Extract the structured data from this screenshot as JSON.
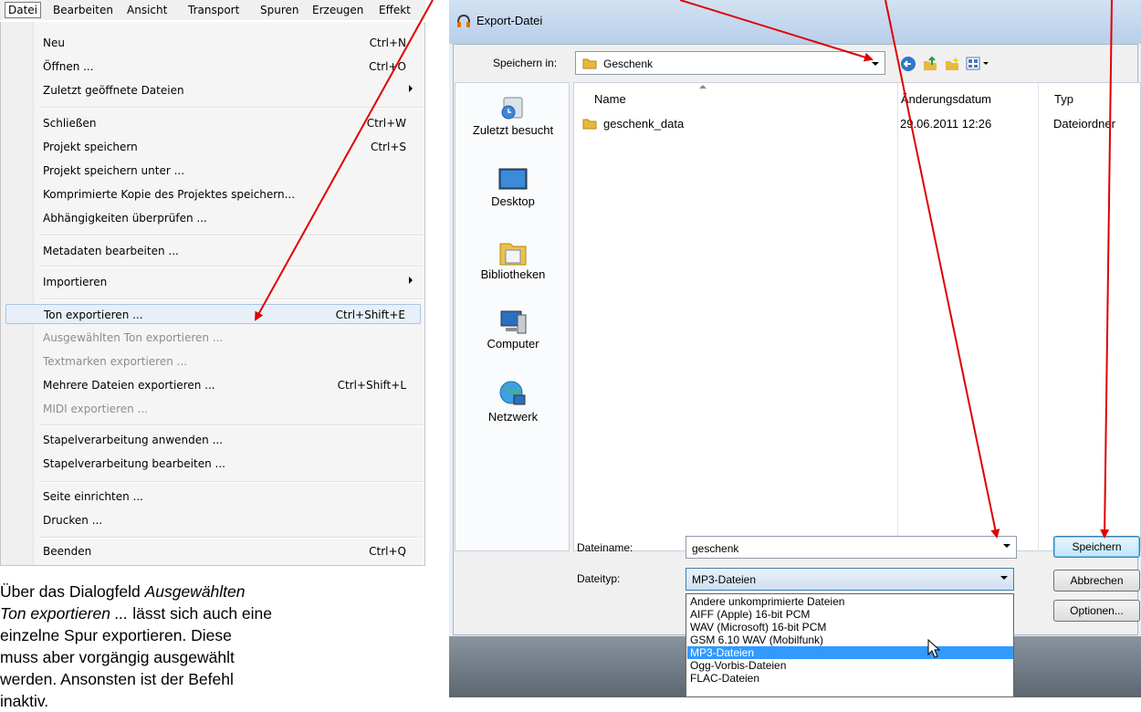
{
  "menubar": {
    "items": [
      "Datei",
      "Bearbeiten",
      "Ansicht",
      "Transport",
      "Spuren",
      "Erzeugen",
      "Effekt"
    ]
  },
  "menu": {
    "items": [
      {
        "label": "Neu",
        "shortcut": "Ctrl+N"
      },
      {
        "label": "Öffnen ...",
        "shortcut": "Ctrl+O"
      },
      {
        "label": "Zuletzt geöffnete Dateien",
        "shortcut": ""
      },
      {
        "label": "Schließen",
        "shortcut": "Ctrl+W"
      },
      {
        "label": "Projekt speichern",
        "shortcut": "Ctrl+S"
      },
      {
        "label": "Projekt speichern unter ...",
        "shortcut": ""
      },
      {
        "label": "Komprimierte Kopie des Projektes speichern...",
        "shortcut": ""
      },
      {
        "label": "Abhängigkeiten überprüfen ...",
        "shortcut": ""
      },
      {
        "label": "Metadaten bearbeiten ...",
        "shortcut": ""
      },
      {
        "label": "Importieren",
        "shortcut": ""
      },
      {
        "label": "Ton exportieren ...",
        "shortcut": "Ctrl+Shift+E"
      },
      {
        "label": "Ausgewählten Ton exportieren ...",
        "shortcut": ""
      },
      {
        "label": "Textmarken exportieren ...",
        "shortcut": ""
      },
      {
        "label": "Mehrere Dateien exportieren ...",
        "shortcut": "Ctrl+Shift+L"
      },
      {
        "label": "MIDI exportieren ...",
        "shortcut": ""
      },
      {
        "label": "Stapelverarbeitung anwenden ...",
        "shortcut": ""
      },
      {
        "label": "Stapelverarbeitung bearbeiten ...",
        "shortcut": ""
      },
      {
        "label": "Seite einrichten ...",
        "shortcut": ""
      },
      {
        "label": "Drucken ...",
        "shortcut": ""
      },
      {
        "label": "Beenden",
        "shortcut": "Ctrl+Q"
      }
    ]
  },
  "caption": {
    "line1": "Über das Dialogfeld ",
    "italic": "Ausgewählten Ton exportieren ...",
    "line2": " lässt sich auch eine einzelne Spur exportieren. Diese muss aber vorgängig ausgewählt werden. Ansonsten ist der Befehl inaktiv."
  },
  "dialog": {
    "title": "Export-Datei",
    "save_in_label": "Speichern in:",
    "save_in_value": "Geschenk",
    "places": [
      "Zuletzt besucht",
      "Desktop",
      "Bibliotheken",
      "Computer",
      "Netzwerk"
    ],
    "columns": [
      "Name",
      "Änderungsdatum",
      "Typ"
    ],
    "files": [
      {
        "name": "geschenk_data",
        "date": "29.06.2011 12:26",
        "type": "Dateiordner"
      }
    ],
    "filename_label": "Dateiname:",
    "filename_value": "geschenk",
    "filetype_label": "Dateityp:",
    "filetype_value": "MP3-Dateien",
    "buttons": {
      "save": "Speichern",
      "cancel": "Abbrechen",
      "options": "Optionen..."
    },
    "filetype_options": [
      "Andere unkomprimierte Dateien",
      "AIFF (Apple) 16-bit PCM",
      "WAV (Microsoft) 16-bit PCM",
      "GSM 6.10 WAV (Mobilfunk)",
      "MP3-Dateien",
      "Ogg-Vorbis-Dateien",
      "FLAC-Dateien"
    ],
    "selected_filetype_index": 4
  },
  "colors": {
    "annotation_arrow": "#e00000",
    "selection": "#3399ff",
    "menu_highlight": "#e7eff8"
  }
}
